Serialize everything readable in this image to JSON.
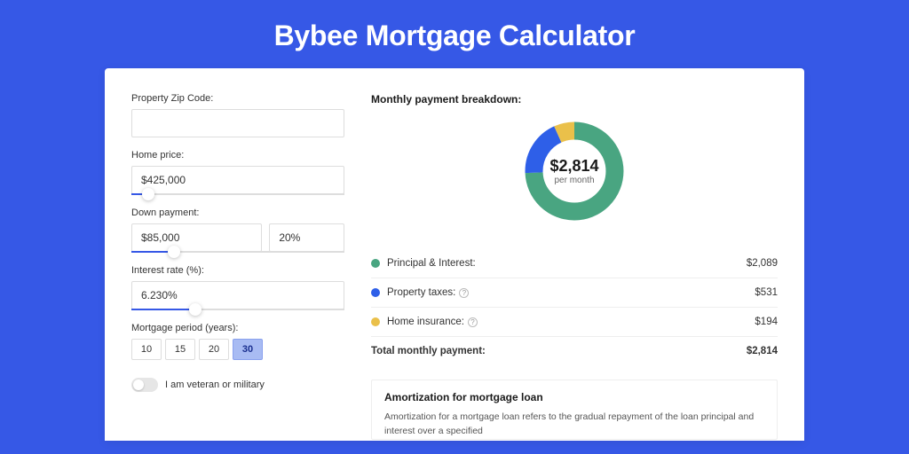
{
  "page": {
    "title": "Bybee Mortgage Calculator"
  },
  "form": {
    "zip": {
      "label": "Property Zip Code:",
      "value": ""
    },
    "home_price": {
      "label": "Home price:",
      "value": "$425,000",
      "slider_pct": 8
    },
    "down_payment": {
      "label": "Down payment:",
      "amount": "$85,000",
      "percent": "20%",
      "slider_pct": 20
    },
    "interest_rate": {
      "label": "Interest rate (%):",
      "value": "6.230%",
      "slider_pct": 30
    },
    "period": {
      "label": "Mortgage period (years):",
      "options": [
        "10",
        "15",
        "20",
        "30"
      ],
      "selected": "30"
    },
    "veteran": {
      "label": "I am veteran or military",
      "on": false
    }
  },
  "breakdown": {
    "title": "Monthly payment breakdown:",
    "center_amount": "$2,814",
    "center_caption": "per month",
    "items": [
      {
        "label": "Principal & Interest:",
        "value": "$2,089",
        "color": "#49a581",
        "pct": 74.2,
        "info": false
      },
      {
        "label": "Property taxes:",
        "value": "$531",
        "color": "#2e5fe8",
        "pct": 18.9,
        "info": true
      },
      {
        "label": "Home insurance:",
        "value": "$194",
        "color": "#eac04a",
        "pct": 6.9,
        "info": true
      }
    ],
    "total": {
      "label": "Total monthly payment:",
      "value": "$2,814"
    }
  },
  "amortization": {
    "title": "Amortization for mortgage loan",
    "body": "Amortization for a mortgage loan refers to the gradual repayment of the loan principal and interest over a specified"
  },
  "chart_data": {
    "type": "pie",
    "title": "Monthly payment breakdown",
    "categories": [
      "Principal & Interest",
      "Property taxes",
      "Home insurance"
    ],
    "values": [
      2089,
      531,
      194
    ],
    "colors": [
      "#49a581",
      "#2e5fe8",
      "#eac04a"
    ],
    "total": 2814,
    "unit": "USD per month"
  }
}
